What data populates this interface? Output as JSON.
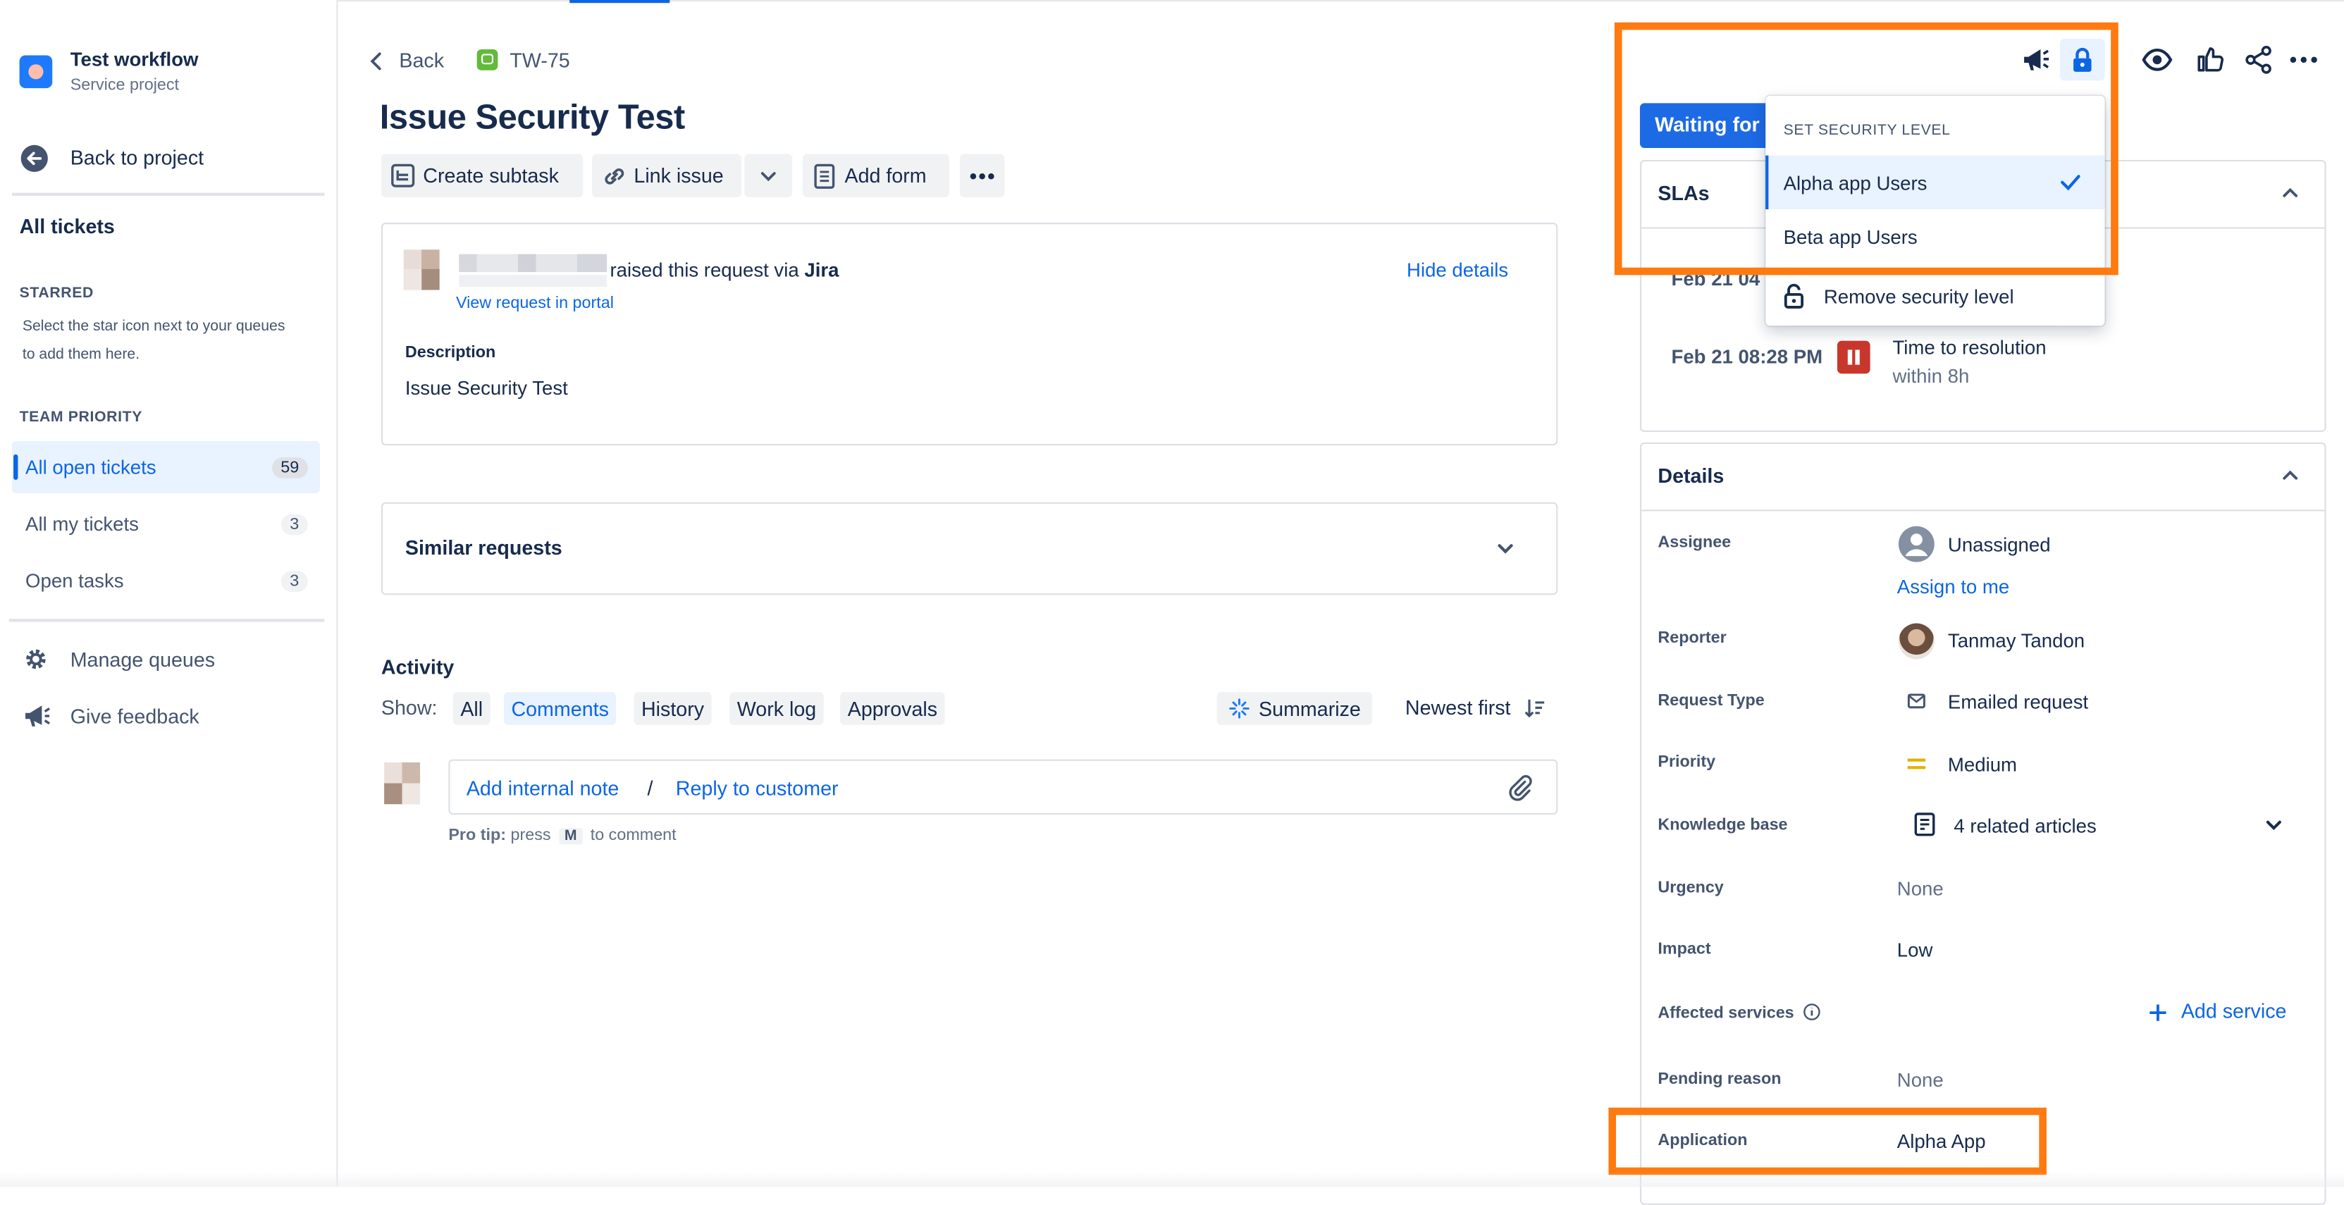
{
  "sidebar": {
    "project_name": "Test workflow",
    "project_type": "Service project",
    "back_label": "Back to project",
    "all_tickets": "All tickets",
    "starred_heading": "STARRED",
    "starred_hint_1": "Select the star icon next to your queues",
    "starred_hint_2": "to add them here.",
    "team_priority_heading": "TEAM PRIORITY",
    "queues": [
      {
        "label": "All open tickets",
        "count": "59"
      },
      {
        "label": "All my tickets",
        "count": "3"
      },
      {
        "label": "Open tasks",
        "count": "3"
      }
    ],
    "manage_queues": "Manage queues",
    "give_feedback": "Give feedback"
  },
  "header": {
    "back": "Back",
    "issue_key": "TW-75",
    "title": "Issue Security Test"
  },
  "toolbar": {
    "create_subtask": "Create subtask",
    "link_issue": "Link issue",
    "add_form": "Add form"
  },
  "request": {
    "raised_text": "raised this request via",
    "channel": "Jira",
    "view_portal": "View request in portal",
    "hide_details": "Hide details",
    "description_label": "Description",
    "description": "Issue Security Test"
  },
  "similar": {
    "label": "Similar requests"
  },
  "activity": {
    "heading": "Activity",
    "show_label": "Show:",
    "tabs": [
      "All",
      "Comments",
      "History",
      "Work log",
      "Approvals"
    ],
    "selected_tab": "Comments",
    "summarize": "Summarize",
    "sort": "Newest first",
    "internal_note": "Add internal note",
    "separator": "/",
    "reply": "Reply to customer",
    "pro_tip_bold": "Pro tip:",
    "pro_tip_press": "press",
    "pro_tip_key": "M",
    "pro_tip_rest": "to comment"
  },
  "status": {
    "button": "Waiting for"
  },
  "security_menu": {
    "heading": "SET SECURITY LEVEL",
    "items": [
      "Alpha app Users",
      "Beta app Users"
    ],
    "selected": "Alpha app Users",
    "remove": "Remove security level"
  },
  "slas": {
    "title": "SLAs",
    "rows": [
      {
        "time": "Feb 21 04"
      },
      {
        "time": "Feb 21 08:28 PM",
        "name": "Time to resolution",
        "detail": "within 8h"
      }
    ]
  },
  "details": {
    "title": "Details",
    "assignee_label": "Assignee",
    "assignee": "Unassigned",
    "assign_to_me": "Assign to me",
    "reporter_label": "Reporter",
    "reporter": "Tanmay Tandon",
    "request_type_label": "Request Type",
    "request_type": "Emailed request",
    "priority_label": "Priority",
    "priority": "Medium",
    "kb_label": "Knowledge base",
    "kb": "4 related articles",
    "urgency_label": "Urgency",
    "urgency": "None",
    "impact_label": "Impact",
    "impact": "Low",
    "affected_label": "Affected services",
    "add_service": "Add service",
    "pending_label": "Pending reason",
    "pending": "None",
    "application_label": "Application",
    "application": "Alpha App"
  },
  "colors": {
    "accent": "#0c66e4",
    "highlight": "#ff7a10",
    "status_button": "#1d6ae5",
    "sla_paused": "#c9372c"
  }
}
